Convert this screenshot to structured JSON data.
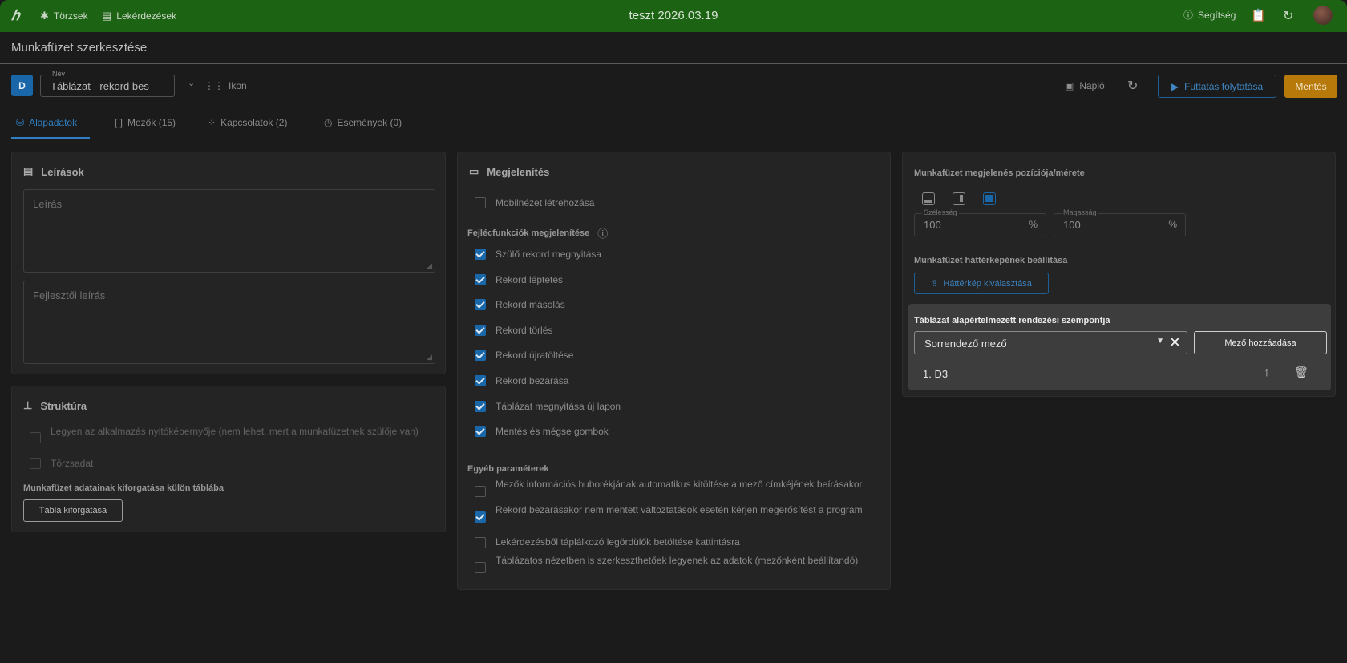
{
  "topbar": {
    "nav": [
      {
        "label": "Törzsek",
        "icon": "star-burst-icon"
      },
      {
        "label": "Lekérdezések",
        "icon": "document-icon"
      }
    ],
    "title": "teszt 2026.03.19",
    "help_label": "Segítség"
  },
  "header": {
    "title": "Munkafüzet szerkesztése",
    "badge": "D",
    "name_label": "Név",
    "name_value": "Táblázat - rekord bes",
    "icon_label": "Ikon",
    "log_label": "Napló",
    "run_label": "Futtatás folytatása",
    "save_label": "Mentés"
  },
  "tabs": [
    {
      "label": "Alapadatok",
      "active": true
    },
    {
      "label": "Mezők (15)",
      "active": false
    },
    {
      "label": "Kapcsolatok (2)",
      "active": false
    },
    {
      "label": "Események (0)",
      "active": false
    }
  ],
  "descriptions": {
    "title": "Leírások",
    "description_placeholder": "Leírás",
    "dev_description_placeholder": "Fejlesztői leírás"
  },
  "structure": {
    "title": "Struktúra",
    "options": [
      {
        "label": "Legyen az alkalmazás nyitóképernyője (nem lehet, mert a munkafüzetnek szülője van)",
        "checked": false
      },
      {
        "label": "Törzsadat",
        "checked": false
      }
    ],
    "pivot_section": "Munkafüzet adatainak kiforgatása külön táblába",
    "pivot_button": "Tábla kiforgatása"
  },
  "display": {
    "title": "Megjelenítés",
    "mobile_view": {
      "label": "Mobilnézet létrehozása",
      "checked": false
    },
    "header_functions_title": "Fejlécfunkciók megjelenítése",
    "header_functions": [
      {
        "label": "Szülő rekord megnyitása",
        "checked": true
      },
      {
        "label": "Rekord léptetés",
        "checked": true
      },
      {
        "label": "Rekord másolás",
        "checked": true
      },
      {
        "label": "Rekord törlés",
        "checked": true
      },
      {
        "label": "Rekord újratöltése",
        "checked": true
      },
      {
        "label": "Rekord bezárása",
        "checked": true
      },
      {
        "label": "Táblázat megnyitása új lapon",
        "checked": true
      },
      {
        "label": "Mentés és mégse gombok",
        "checked": true
      }
    ],
    "other_title": "Egyéb paraméterek",
    "other": [
      {
        "label": "Mezők információs buborékjának automatikus kitöltése a mező címkéjének beírásakor",
        "checked": false
      },
      {
        "label": "Rekord bezárásakor nem mentett változtatások esetén kérjen megerősítést a program",
        "checked": true
      },
      {
        "label": "Lekérdezésből táplálkozó legördülők betöltése kattintásra",
        "checked": false
      },
      {
        "label": "Táblázatos nézetben is szerkeszthetőek legyenek az adatok (mezőnként beállítandó)",
        "checked": false
      }
    ]
  },
  "layout_panel": {
    "position_title": "Munkafüzet megjelenés pozíciója/mérete",
    "selected_position": "full",
    "width_label": "Szélesség",
    "width_value": "100",
    "height_label": "Magasság",
    "height_value": "100",
    "unit": "%",
    "background_title": "Munkafüzet háttérképének beállítása",
    "background_button": "Háttérkép kiválasztása"
  },
  "sort": {
    "title": "Táblázat alapértelmezett rendezési szempontja",
    "select_value": "Sorrendező mező",
    "add_button": "Mező hozzáadása",
    "items": [
      "1. D3"
    ]
  },
  "colors": {
    "topbar": "#1d6314",
    "accent": "#1967a8",
    "save": "#b6790a"
  }
}
